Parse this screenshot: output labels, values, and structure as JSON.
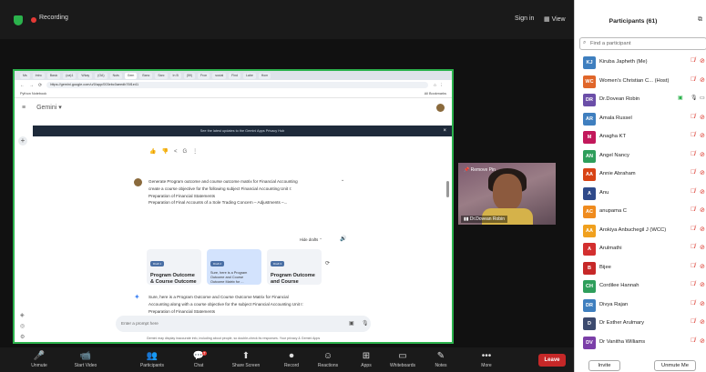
{
  "meeting": {
    "recording_label": "Recording",
    "sign_in": "Sign in",
    "view": "View",
    "shield_icon": "shield-icon"
  },
  "browser": {
    "tabs": [
      "Ms",
      "Intro",
      "Basic",
      "(oa)1",
      "Wkay",
      "(OA)",
      "Nuts",
      "Gem",
      "Banc",
      "Sarc",
      "In B",
      "(59)",
      "Fron",
      "social",
      "Find",
      "Labe",
      "Hom"
    ],
    "url": "https://gemini.google.com/u/0/app/003ebc0aeedb76f1e41",
    "bookmark_left": "Python Notebook",
    "bookmark_right": "All Bookmarks",
    "app_name": "Gemini",
    "banner_text": "See the latest updates to the Gemini Apps Privacy Hub",
    "prompt_lines": [
      "Generate Program outcome and course outcome matrix for Financial Accounting",
      "create a course objective for the following subject Financial Accounting Unit I:",
      "Preparation of Financial Statements",
      "Preparation of Final Accounts of a Sole Trading Concern – Adjustments –..."
    ],
    "hide_drafts": "Hide drafts",
    "drafts": [
      {
        "chip": "Draft 1",
        "title": "Program Outcome & Course Outcome",
        "small": ""
      },
      {
        "chip": "Draft 2",
        "title": "",
        "small": "Sure, here is a Program Outcome and Course Outcome Matrix for ..."
      },
      {
        "chip": "Draft 3",
        "title": "Program Outcome and Course",
        "small": ""
      }
    ],
    "answer_lines": [
      "Sure, here is a Program Outcome and Course Outcome Matrix for Financial",
      "Accounting along with a course objective for the subject Financial Accounting Unit I:",
      "Preparation of Financial Statements"
    ],
    "input_placeholder": "Enter a prompt here",
    "disclaimer": "Gemini may display inaccurate info, including about people, so double-check its responses. Your privacy & Gemini Apps"
  },
  "camera": {
    "remove_pin": "Remove Pin",
    "name": "Dr.Dovean Robin"
  },
  "toolbar": {
    "items": [
      {
        "icon": "🎤",
        "label": "Unmute"
      },
      {
        "icon": "📹",
        "label": "Start Video"
      },
      {
        "icon": "👥",
        "label": "Participants",
        "count": "61"
      },
      {
        "icon": "💬",
        "label": "Chat",
        "badge": "7"
      },
      {
        "icon": "⬆",
        "label": "Share Screen"
      },
      {
        "icon": "⏺",
        "label": "Record"
      },
      {
        "icon": "☺",
        "label": "Reactions"
      },
      {
        "icon": "⊞",
        "label": "Apps"
      },
      {
        "icon": "▭",
        "label": "Whiteboards"
      },
      {
        "icon": "✎",
        "label": "Notes"
      },
      {
        "icon": "•••",
        "label": "More"
      }
    ],
    "leave": "Leave"
  },
  "participants": {
    "title": "Participants (61)",
    "search_placeholder": "Find a participant",
    "list": [
      {
        "initials": "KJ",
        "color": "#3f7fbf",
        "name": "Kiruba Japheth (Me)"
      },
      {
        "initials": "WC",
        "color": "#e0662a",
        "name": "Women's Christian C... (Host)"
      },
      {
        "initials": "DR",
        "color": "#6b4ea8",
        "name": "Dr.Dovean Robin"
      },
      {
        "initials": "AR",
        "color": "#3f7fbf",
        "name": "Amala Russel"
      },
      {
        "initials": "M",
        "color": "#c2185b",
        "name": "Anagha KT"
      },
      {
        "initials": "AN",
        "color": "#2e9e5b",
        "name": "Angel Nancy"
      },
      {
        "initials": "AA",
        "color": "#d84315",
        "name": "Annie Abraham"
      },
      {
        "initials": "A",
        "color": "#2f4a8a",
        "name": "Anu"
      },
      {
        "initials": "AC",
        "color": "#ef8b1e",
        "name": "anupama C"
      },
      {
        "initials": "AA",
        "color": "#f0a01e",
        "name": "Arokiya Anbuchegil J (WCC)"
      },
      {
        "initials": "A",
        "color": "#d32f2f",
        "name": "Arulmathi"
      },
      {
        "initials": "B",
        "color": "#c62828",
        "name": "Bijee"
      },
      {
        "initials": "CH",
        "color": "#2e9e5b",
        "name": "Cordilee Hannah"
      },
      {
        "initials": "DR",
        "color": "#3f7fbf",
        "name": "Divya Rajan"
      },
      {
        "initials": "D",
        "color": "#3c4a6e",
        "name": "Dr Esther Arulmary"
      },
      {
        "initials": "DV",
        "color": "#7b3fa8",
        "name": "Dr Vanitha Williams"
      }
    ],
    "invite": "Invite",
    "unmute_me": "Unmute Me"
  }
}
